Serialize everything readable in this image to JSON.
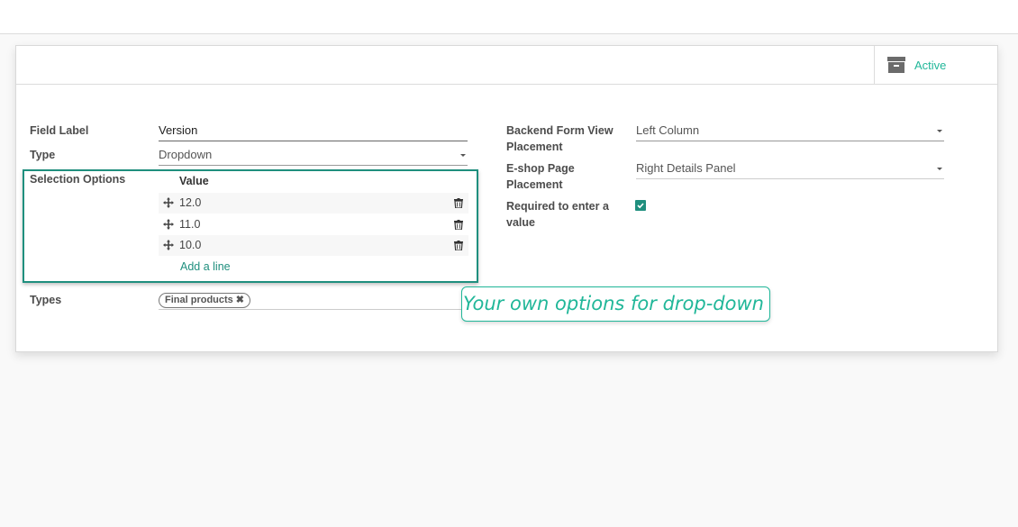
{
  "header": {
    "active_label": "Active"
  },
  "form": {
    "field_label": {
      "label": "Field Label",
      "value": "Version"
    },
    "type": {
      "label": "Type",
      "value": "Dropdown"
    },
    "selection_options": {
      "label": "Selection Options",
      "column_header": "Value",
      "rows": [
        "12.0",
        "11.0",
        "10.0"
      ],
      "add_line": "Add a line"
    },
    "types": {
      "label": "Types",
      "tag": "Final products"
    },
    "backend_placement": {
      "label_line1": "Backend Form View",
      "label_line2": "Placement",
      "value": "Left Column"
    },
    "eshop_placement": {
      "label_line1": "E-shop Page",
      "label_line2": "Placement",
      "value": "Right Details Panel"
    },
    "required": {
      "label_line1": "Required to enter a",
      "label_line2": "value",
      "checked": true
    }
  },
  "callout": {
    "text": "Your own options for drop-down"
  },
  "colors": {
    "accent": "#21b799",
    "teal_dark": "#1f8f7e"
  }
}
